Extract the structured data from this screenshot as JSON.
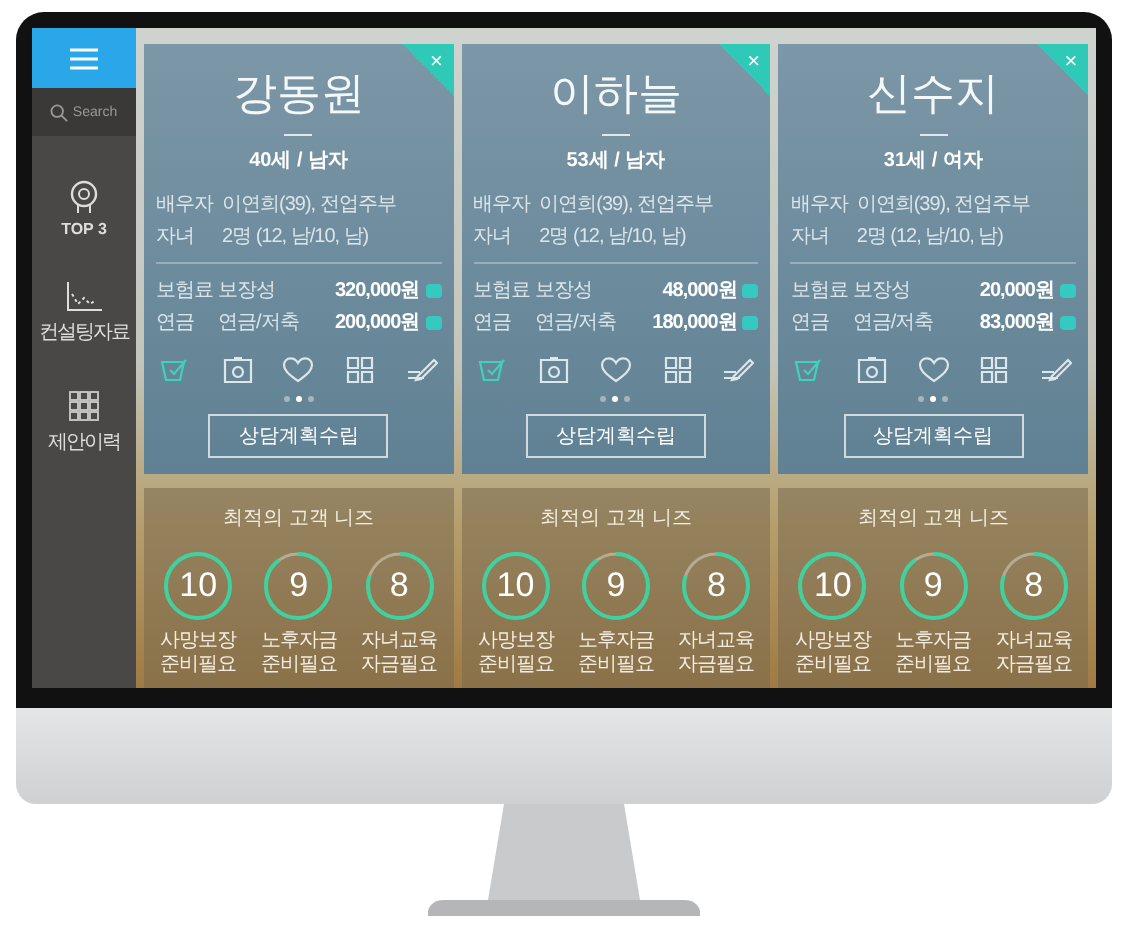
{
  "sidebar": {
    "items": [
      {
        "kind": "menu"
      },
      {
        "kind": "search",
        "label": "Search"
      },
      {
        "kind": "medal",
        "label": "TOP 3"
      },
      {
        "kind": "chart",
        "label": "컨설팅자료"
      },
      {
        "kind": "grid",
        "label": "제안이력"
      }
    ]
  },
  "customers": [
    {
      "name": "강동원",
      "close": "×",
      "age_gender": "40세 / 남자",
      "details": [
        {
          "label": "배우자",
          "value": "이연희(39), 전업주부"
        },
        {
          "label": "자녀",
          "value": "2명 (12, 남/10, 남)"
        }
      ],
      "premiums": [
        {
          "label": "보험료",
          "type": "보장성",
          "amount": "320,000원"
        },
        {
          "label": "연금",
          "type": "연금/저축",
          "amount": "200,000원"
        }
      ],
      "icons": [
        {
          "kind": "check",
          "selected": true
        },
        {
          "kind": "camera",
          "selected": false
        },
        {
          "kind": "heart",
          "selected": false
        },
        {
          "kind": "grid",
          "selected": false
        },
        {
          "kind": "pen",
          "selected": false
        }
      ],
      "dots": [
        {
          "selected": false
        },
        {
          "selected": true
        },
        {
          "selected": false
        }
      ],
      "button": "상담계획수립",
      "needs": {
        "title": "최적의 고객 니즈",
        "gauges": [
          {
            "value": "10",
            "level": 1,
            "label": "사망보장 준비필요"
          },
          {
            "value": "9",
            "level": 0.9,
            "label": "노후자금 준비필요"
          },
          {
            "value": "8",
            "level": 0.8,
            "label": "자녀교육 자금필요"
          }
        ]
      }
    },
    {
      "name": "이하늘",
      "close": "×",
      "age_gender": "53세 / 남자",
      "details": [
        {
          "label": "배우자",
          "value": "이연희(39), 전업주부"
        },
        {
          "label": "자녀",
          "value": "2명 (12, 남/10, 남)"
        }
      ],
      "premiums": [
        {
          "label": "보험료",
          "type": "보장성",
          "amount": "48,000원"
        },
        {
          "label": "연금",
          "type": "연금/저축",
          "amount": "180,000원"
        }
      ],
      "icons": [
        {
          "kind": "check",
          "selected": true
        },
        {
          "kind": "camera",
          "selected": false
        },
        {
          "kind": "heart",
          "selected": false
        },
        {
          "kind": "grid",
          "selected": false
        },
        {
          "kind": "pen",
          "selected": false
        }
      ],
      "dots": [
        {
          "selected": false
        },
        {
          "selected": true
        },
        {
          "selected": false
        }
      ],
      "button": "상담계획수립",
      "needs": {
        "title": "최적의 고객 니즈",
        "gauges": [
          {
            "value": "10",
            "level": 1,
            "label": "사망보장 준비필요"
          },
          {
            "value": "9",
            "level": 0.9,
            "label": "노후자금 준비필요"
          },
          {
            "value": "8",
            "level": 0.8,
            "label": "자녀교육 자금필요"
          }
        ]
      }
    },
    {
      "name": "신수지",
      "close": "×",
      "age_gender": "31세 / 여자",
      "details": [
        {
          "label": "배우자",
          "value": "이연희(39), 전업주부"
        },
        {
          "label": "자녀",
          "value": "2명 (12, 남/10, 남)"
        }
      ],
      "premiums": [
        {
          "label": "보험료",
          "type": "보장성",
          "amount": "20,000원"
        },
        {
          "label": "연금",
          "type": "연금/저축",
          "amount": "83,000원"
        }
      ],
      "icons": [
        {
          "kind": "check",
          "selected": true
        },
        {
          "kind": "camera",
          "selected": false
        },
        {
          "kind": "heart",
          "selected": false
        },
        {
          "kind": "grid",
          "selected": false
        },
        {
          "kind": "pen",
          "selected": false
        }
      ],
      "dots": [
        {
          "selected": false
        },
        {
          "selected": true
        },
        {
          "selected": false
        }
      ],
      "button": "상담계획수립",
      "needs": {
        "title": "최적의 고객 니즈",
        "gauges": [
          {
            "value": "10",
            "level": 1,
            "label": "사망보장 준비필요"
          },
          {
            "value": "9",
            "level": 0.9,
            "label": "노후자금 준비필요"
          },
          {
            "value": "8",
            "level": 0.8,
            "label": "자녀교육 자금필요"
          }
        ]
      }
    }
  ]
}
